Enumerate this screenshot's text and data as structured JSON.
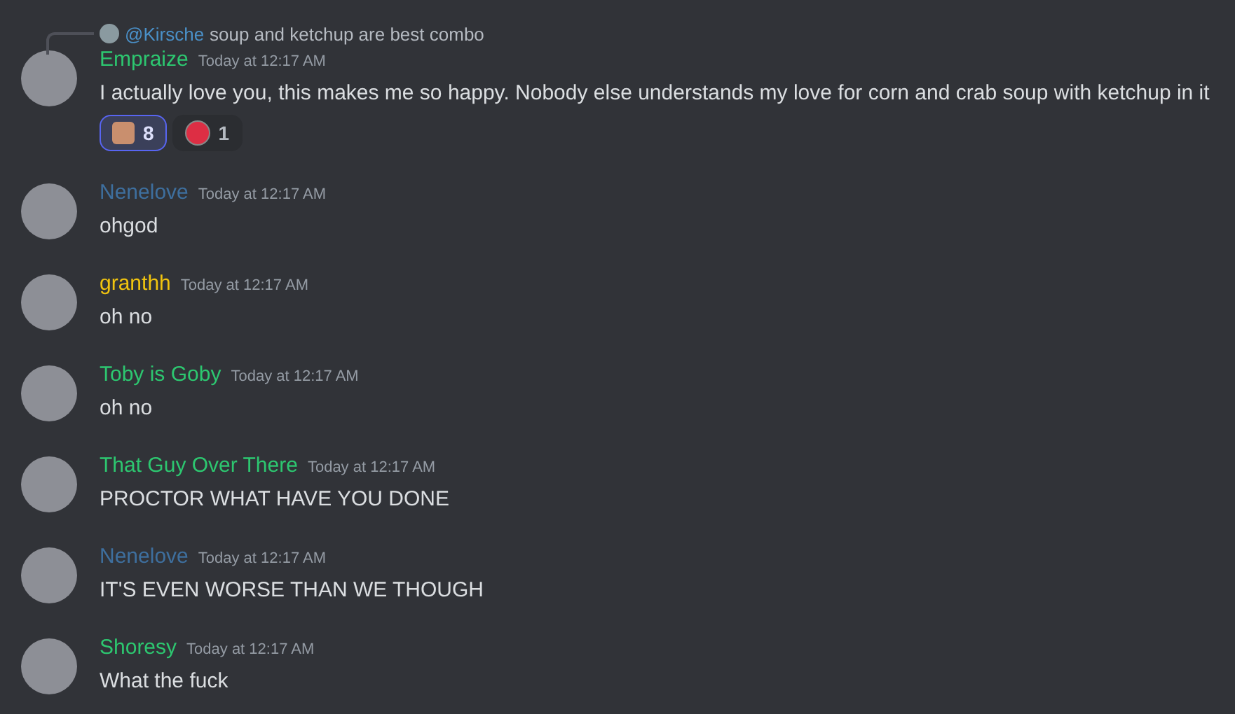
{
  "messages": [
    {
      "reply": {
        "mention": "@Kirsche",
        "text": "soup and ketchup are best combo"
      },
      "author": "Empraize",
      "color": "#2dc770",
      "time": "Today at 12:17 AM",
      "text": "I actually love you, this makes me so happy. Nobody else understands my love for corn and crab soup with ketchup in it",
      "reactions": [
        {
          "count": "8",
          "selected": true,
          "kind": "face"
        },
        {
          "count": "1",
          "selected": false,
          "kind": "red-circle"
        }
      ]
    },
    {
      "author": "Nenelove",
      "color": "#3e6f9e",
      "time": "Today at 12:17 AM",
      "text": "ohgod"
    },
    {
      "author": "granthh",
      "color": "#f1c40f",
      "time": "Today at 12:17 AM",
      "text": "oh no"
    },
    {
      "author": "Toby is Goby",
      "color": "#2dc770",
      "time": "Today at 12:17 AM",
      "text": "oh no"
    },
    {
      "author": "That Guy Over There",
      "color": "#2dc770",
      "time": "Today at 12:17 AM",
      "text": "PROCTOR WHAT HAVE YOU DONE"
    },
    {
      "author": "Nenelove",
      "color": "#3e6f9e",
      "time": "Today at 12:17 AM",
      "text": "IT'S EVEN WORSE THAN WE THOUGH"
    },
    {
      "author": "Shoresy",
      "color": "#2dc770",
      "time": "Today at 12:17 AM",
      "text": "What the fuck"
    }
  ]
}
